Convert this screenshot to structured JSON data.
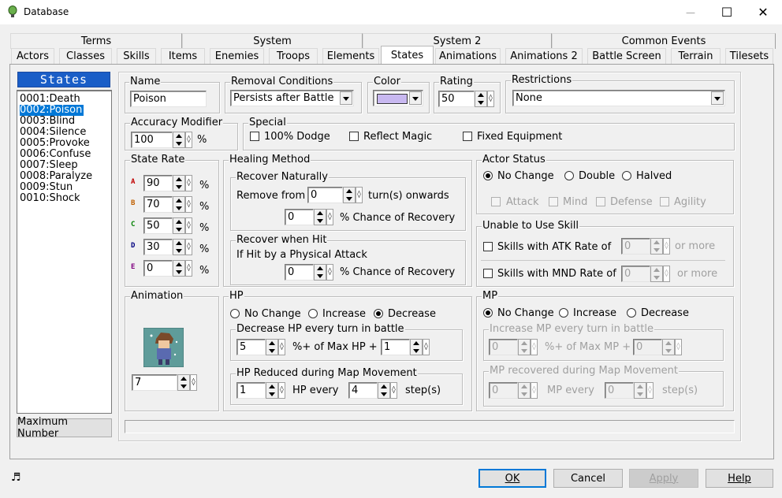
{
  "window": {
    "title": "Database",
    "minimize": "—",
    "maximize": "☐",
    "close": "✕"
  },
  "tabs_row1": [
    "Terms",
    "System",
    "System 2",
    "Common Events"
  ],
  "tabs_row2": [
    "Actors",
    "Classes",
    "Skills",
    "Items",
    "Enemies",
    "Troops",
    "Elements",
    "States",
    "Animations",
    "Animations 2",
    "Battle Screen",
    "Terrain",
    "Tilesets"
  ],
  "active_tab": "States",
  "list": {
    "header": "States",
    "items": [
      "0001:Death",
      "0002:Poison",
      "0003:Blind",
      "0004:Silence",
      "0005:Provoke",
      "0006:Confuse",
      "0007:Sleep",
      "0008:Paralyze",
      "0009:Stun",
      "0010:Shock"
    ],
    "selected_index": 1,
    "max_button": "Maximum Number"
  },
  "name": {
    "label": "Name",
    "value": "Poison"
  },
  "removal": {
    "label": "Removal Conditions",
    "value": "Persists after Battle"
  },
  "color": {
    "label": "Color",
    "swatch": "#c8b8f0"
  },
  "rating": {
    "label": "Rating",
    "value": "50"
  },
  "restrictions": {
    "label": "Restrictions",
    "value": "None"
  },
  "accuracy": {
    "label": "Accuracy Modifier",
    "value": "100",
    "unit": "%"
  },
  "special": {
    "label": "Special",
    "options": [
      "100% Dodge",
      "Reflect Magic",
      "Fixed Equipment"
    ]
  },
  "state_rate": {
    "label": "State Rate",
    "rows": [
      {
        "letter": "A",
        "value": "90",
        "color": "#c00000"
      },
      {
        "letter": "B",
        "value": "70",
        "color": "#c06000"
      },
      {
        "letter": "C",
        "value": "50",
        "color": "#008000"
      },
      {
        "letter": "D",
        "value": "30",
        "color": "#000080"
      },
      {
        "letter": "E",
        "value": "0",
        "color": "#800080"
      }
    ],
    "unit": "%"
  },
  "healing": {
    "label": "Healing Method",
    "naturally": {
      "label": "Recover Naturally",
      "remove_from": "Remove from",
      "turns_value": "0",
      "turns_suffix": "turn(s) onwards",
      "chance_value": "0",
      "chance_suffix": "% Chance of Recovery"
    },
    "when_hit": {
      "label": "Recover when Hit",
      "desc": "If Hit by a Physical Attack",
      "chance_value": "0",
      "chance_suffix": "% Chance of Recovery"
    }
  },
  "actor_status": {
    "label": "Actor Status",
    "radios": [
      "No Change",
      "Double",
      "Halved"
    ],
    "selected": 0,
    "checks": [
      "Attack",
      "Mind",
      "Defense",
      "Agility"
    ]
  },
  "unable_skill": {
    "label": "Unable to Use Skill",
    "atk_label": "Skills with ATK Rate of",
    "atk_value": "0",
    "atk_suffix": "or more",
    "mnd_label": "Skills with MND Rate of",
    "mnd_value": "0",
    "mnd_suffix": "or more"
  },
  "animation": {
    "label": "Animation",
    "value": "7"
  },
  "hp": {
    "label": "HP",
    "radios": [
      "No Change",
      "Increase",
      "Decrease"
    ],
    "selected": 2,
    "every_turn": {
      "label": "Decrease HP every turn in battle",
      "pct_value": "5",
      "pct_suffix": "%+ of Max HP +",
      "flat_value": "1"
    },
    "map": {
      "label": "HP Reduced during Map Movement",
      "amount": "1",
      "every": "HP every",
      "steps": "4",
      "steps_suffix": "step(s)"
    }
  },
  "mp": {
    "label": "MP",
    "radios": [
      "No Change",
      "Increase",
      "Decrease"
    ],
    "selected": 0,
    "every_turn": {
      "label": "Increase MP every turn in battle",
      "pct_value": "0",
      "pct_suffix": "%+ of Max MP +",
      "flat_value": "0"
    },
    "map": {
      "label": "MP recovered during Map Movement",
      "amount": "0",
      "every": "MP every",
      "steps": "0",
      "steps_suffix": "step(s)"
    }
  },
  "buttons": {
    "ok": "OK",
    "cancel": "Cancel",
    "apply": "Apply",
    "help": "Help"
  },
  "status_icon": "music-note-icon"
}
